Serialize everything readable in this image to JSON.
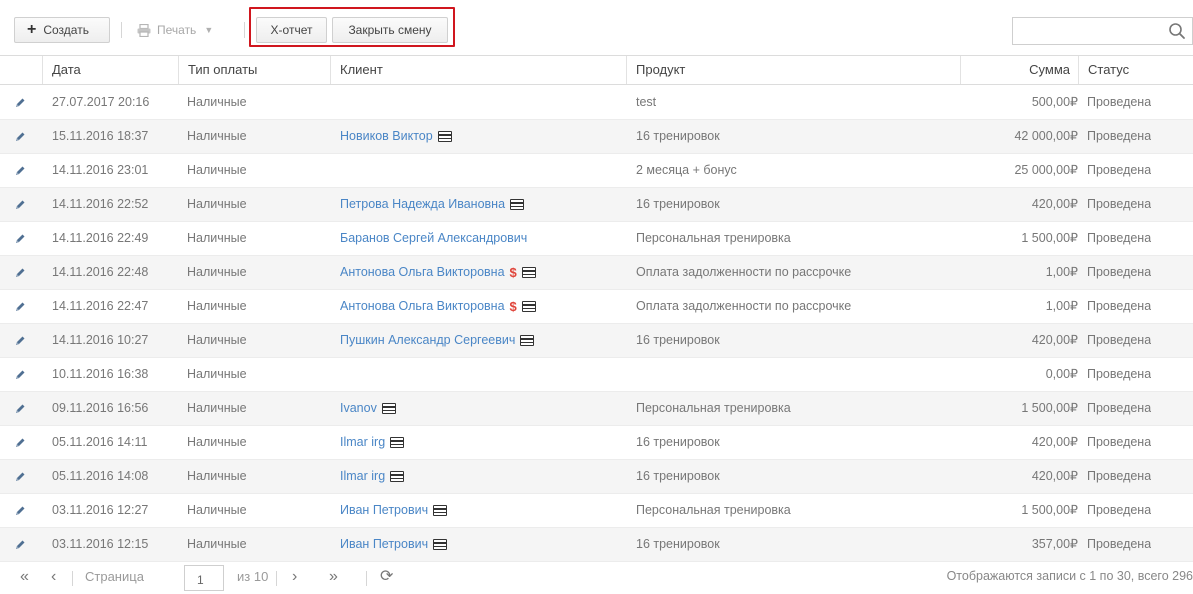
{
  "toolbar": {
    "create_label": "Создать",
    "print_label": "Печать",
    "x_report_label": "Х-отчет",
    "close_shift_label": "Закрыть смену",
    "search_placeholder": ""
  },
  "columns": {
    "date": "Дата",
    "payment_type": "Тип оплаты",
    "client": "Клиент",
    "product": "Продукт",
    "sum": "Сумма",
    "status": "Статус"
  },
  "rows": [
    {
      "date": "27.07.2017 20:16",
      "payment_type": "Наличные",
      "client": "",
      "dollar": "",
      "card": false,
      "product": "test",
      "sum": "500,00₽",
      "status": "Проведена"
    },
    {
      "date": "15.11.2016 18:37",
      "payment_type": "Наличные",
      "client": "Новиков Виктор",
      "dollar": "",
      "card": true,
      "product": "16 тренировок",
      "sum": "42 000,00₽",
      "status": "Проведена"
    },
    {
      "date": "14.11.2016 23:01",
      "payment_type": "Наличные",
      "client": "",
      "dollar": "",
      "card": false,
      "product": "2 месяца + бонус",
      "sum": "25 000,00₽",
      "status": "Проведена"
    },
    {
      "date": "14.11.2016 22:52",
      "payment_type": "Наличные",
      "client": "Петрова Надежда Ивановна",
      "dollar": "",
      "card": true,
      "product": "16 тренировок",
      "sum": "420,00₽",
      "status": "Проведена"
    },
    {
      "date": "14.11.2016 22:49",
      "payment_type": "Наличные",
      "client": "Баранов Сергей Александрович",
      "dollar": "",
      "card": false,
      "product": "Персональная тренировка",
      "sum": "1 500,00₽",
      "status": "Проведена"
    },
    {
      "date": "14.11.2016 22:48",
      "payment_type": "Наличные",
      "client": "Антонова Ольга Викторовна",
      "dollar": "$",
      "card": true,
      "product": "Оплата задолженности по рассрочке",
      "sum": "1,00₽",
      "status": "Проведена"
    },
    {
      "date": "14.11.2016 22:47",
      "payment_type": "Наличные",
      "client": "Антонова Ольга Викторовна",
      "dollar": "$",
      "card": true,
      "product": "Оплата задолженности по рассрочке",
      "sum": "1,00₽",
      "status": "Проведена"
    },
    {
      "date": "14.11.2016 10:27",
      "payment_type": "Наличные",
      "client": "Пушкин Александр Сергеевич",
      "dollar": "",
      "card": true,
      "product": "16 тренировок",
      "sum": "420,00₽",
      "status": "Проведена"
    },
    {
      "date": "10.11.2016 16:38",
      "payment_type": "Наличные",
      "client": "",
      "dollar": "",
      "card": false,
      "product": "",
      "sum": "0,00₽",
      "status": "Проведена"
    },
    {
      "date": "09.11.2016 16:56",
      "payment_type": "Наличные",
      "client": "Ivanov",
      "dollar": "",
      "card": true,
      "product": "Персональная тренировка",
      "sum": "1 500,00₽",
      "status": "Проведена"
    },
    {
      "date": "05.11.2016 14:11",
      "payment_type": "Наличные",
      "client": "Ilmar irg",
      "dollar": "",
      "card": true,
      "product": "16 тренировок",
      "sum": "420,00₽",
      "status": "Проведена"
    },
    {
      "date": "05.11.2016 14:08",
      "payment_type": "Наличные",
      "client": "Ilmar irg",
      "dollar": "",
      "card": true,
      "product": "16 тренировок",
      "sum": "420,00₽",
      "status": "Проведена"
    },
    {
      "date": "03.11.2016 12:27",
      "payment_type": "Наличные",
      "client": "Иван Петрович",
      "dollar": "",
      "card": true,
      "product": "Персональная тренировка",
      "sum": "1 500,00₽",
      "status": "Проведена"
    },
    {
      "date": "03.11.2016 12:15",
      "payment_type": "Наличные",
      "client": "Иван Петрович",
      "dollar": "",
      "card": true,
      "product": "16 тренировок",
      "sum": "357,00₽",
      "status": "Проведена"
    }
  ],
  "pager": {
    "page_label": "Страница",
    "page_value": "1",
    "of_label": "из 10",
    "info": "Отображаются записи с 1 по 30, всего 296"
  },
  "colors": {
    "highlight": "#d0161e",
    "link": "#4a86c6",
    "dollar": "#e0443a"
  }
}
